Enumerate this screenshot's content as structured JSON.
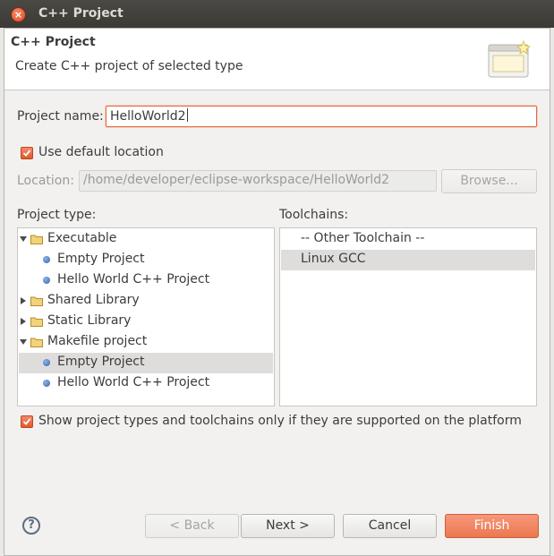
{
  "window": {
    "title": "C++ Project",
    "close_icon": "close-icon"
  },
  "header": {
    "title": "C++ Project",
    "description": "Create C++ project of selected type",
    "icon": "wizard-banner-icon"
  },
  "form": {
    "project_name_label": "Project name:",
    "project_name_value": "HelloWorld2",
    "use_default_location_label": "Use default location",
    "use_default_location_checked": true,
    "location_label": "Location:",
    "location_value": "/home/developer/eclipse-workspace/HelloWorld2",
    "browse_label": "Browse..."
  },
  "project_type": {
    "label": "Project type:",
    "items": [
      {
        "label": "Executable",
        "kind": "folder",
        "expanded": true
      },
      {
        "label": "Empty Project",
        "kind": "item"
      },
      {
        "label": "Hello World C++ Project",
        "kind": "item"
      },
      {
        "label": "Shared Library",
        "kind": "folder",
        "expanded": false
      },
      {
        "label": "Static Library",
        "kind": "folder",
        "expanded": false
      },
      {
        "label": "Makefile project",
        "kind": "folder",
        "expanded": true
      },
      {
        "label": "Empty Project",
        "kind": "item",
        "selected": true
      },
      {
        "label": "Hello World C++ Project",
        "kind": "item"
      }
    ]
  },
  "toolchains": {
    "label": "Toolchains:",
    "items": [
      {
        "label": "-- Other Toolchain --"
      },
      {
        "label": "Linux GCC",
        "selected": true
      }
    ]
  },
  "filter_checkbox": {
    "label": "Show project types and toolchains only if they are supported on the platform",
    "checked": true
  },
  "buttons": {
    "back": "< Back",
    "next": "Next >",
    "cancel": "Cancel",
    "finish": "Finish"
  },
  "colors": {
    "accent": "#e66a3e",
    "finish_button": "#f0825c",
    "titlebar": "#3f3e3a",
    "dialog_bg": "#f2f1f0",
    "selection": "#dedddb"
  }
}
